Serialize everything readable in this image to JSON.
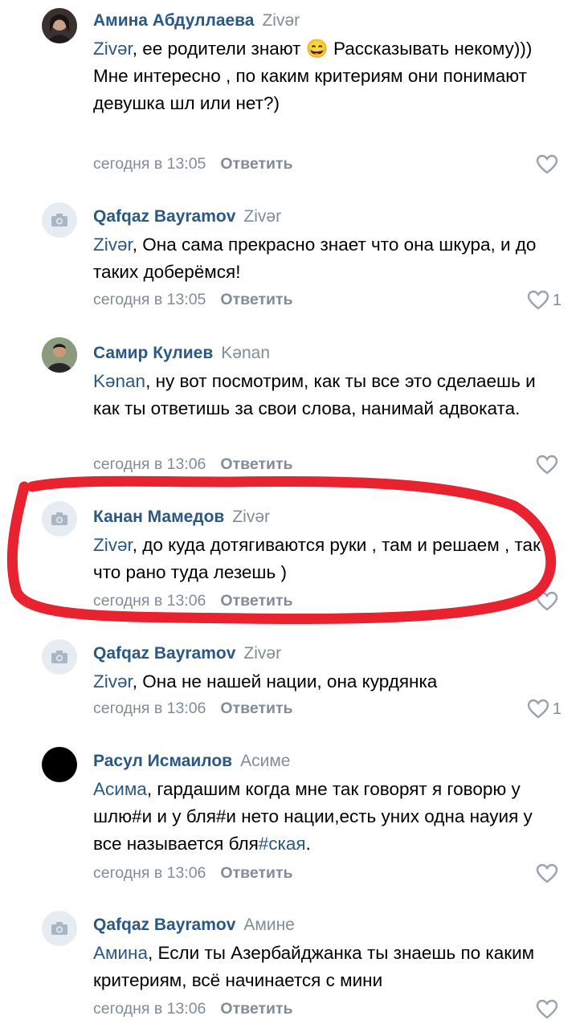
{
  "comments": [
    {
      "author": "Амина Абдуллаева",
      "reply_to": "Zivər",
      "mention": "Zivər",
      "text": ",   ее родители знают 😄 Рассказывать некому))) Мне интересно , по каким критериям они понимают девушка шл или нет?)",
      "time": "сегодня в 13:05",
      "reply_label": "Ответить",
      "likes": ""
    },
    {
      "author": "Qafqaz Bayramov",
      "reply_to": "Zivər",
      "mention": "Zivər",
      "text": ", Она сама прекрасно знает что она шкура, и до таких доберёмся!",
      "time": "сегодня в 13:05",
      "reply_label": "Ответить",
      "likes": "1"
    },
    {
      "author": "Самир Кулиев",
      "reply_to": "Kənan",
      "mention": "Kənan",
      "text": ", ну вот посмотрим, как ты все это сделаешь и как ты ответишь за свои слова, нанимай адвоката.",
      "time": "сегодня в 13:06",
      "reply_label": "Ответить",
      "likes": ""
    },
    {
      "author": "Канан Мамедов",
      "reply_to": "Zivər",
      "mention": "Zivər",
      "text": ", до куда дотягиваются руки , там и решаем , так что рано туда лезешь )",
      "time": "сегодня в 13:06",
      "reply_label": "Ответить",
      "likes": ""
    },
    {
      "author": "Qafqaz Bayramov",
      "reply_to": "Zivər",
      "mention": "Zivər",
      "text": ", Она не нашей нации, она курдянка",
      "time": "сегодня в 13:06",
      "reply_label": "Ответить",
      "likes": "1"
    },
    {
      "author": "Расул Исмаилов",
      "reply_to": "Асиме",
      "mention": "Асима",
      "text": ", гардашим когда мне так говорят я говорю у шлю#и и у бля#и нето нации,есть уних одна науия у все называется бля",
      "text_link": "#ская",
      "text_end": ".",
      "time": "сегодня в 13:06",
      "reply_label": "Ответить",
      "likes": ""
    },
    {
      "author": "Qafqaz Bayramov",
      "reply_to": "Амине",
      "mention": "Амина",
      "text": ", Если ты Азербайджанка ты знаешь по каким критериям, всё начинается с мини",
      "time": "сегодня в 13:06",
      "reply_label": "Ответить",
      "likes": ""
    }
  ],
  "icons": {
    "avatar_placeholder": "camera-icon",
    "like": "heart-icon"
  },
  "colors": {
    "link": "#2a5885",
    "meta": "#818c99",
    "highlight": "#e8222f"
  }
}
